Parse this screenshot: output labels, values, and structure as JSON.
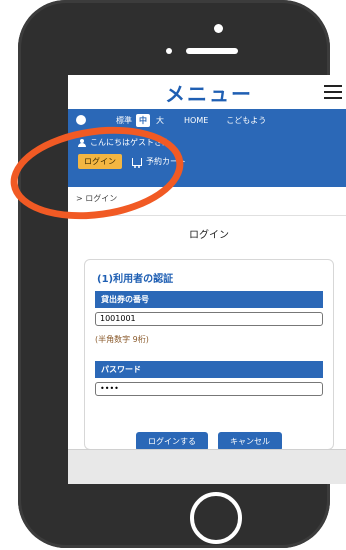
{
  "app": {
    "title": "メニュー"
  },
  "header_bar": {
    "small": "標準",
    "medium": "中",
    "large": "大",
    "home": "HOME",
    "kids": "こどもよう"
  },
  "account": {
    "greeting": "こんにちはゲストさん",
    "login_label": "ログイン",
    "cart_label": "予約カート"
  },
  "breadcrumb": "> ログイン",
  "page": {
    "title": "ログイン"
  },
  "auth": {
    "title": "(1)利用者の認証",
    "library_card_label": "貸出券の番号",
    "library_card_value": "1001001",
    "hint": "(半角数字 9桁)",
    "password_label": "パスワード",
    "password_value": "••••",
    "submit_label": "ログインする",
    "cancel_label": "キャンセル"
  },
  "colors": {
    "accent": "#2b68b7",
    "login_chip": "#f3b642",
    "highlight": "#f15a24"
  }
}
